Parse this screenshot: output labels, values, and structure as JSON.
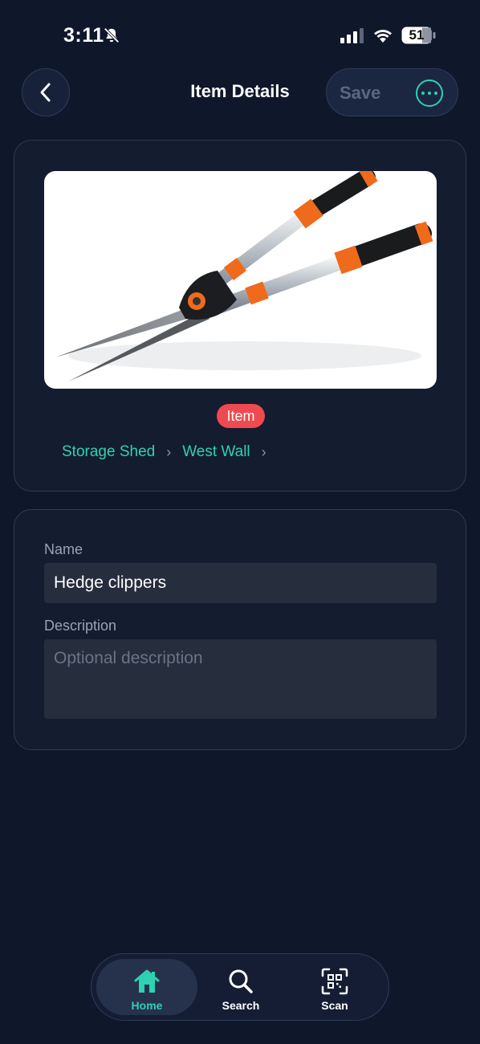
{
  "status_bar": {
    "time": "3:11",
    "battery": "51"
  },
  "header": {
    "title": "Item Details",
    "save_label": "Save"
  },
  "item": {
    "badge": "Item",
    "breadcrumb": [
      "Storage Shed",
      "West Wall"
    ],
    "name_label": "Name",
    "name_value": "Hedge clippers",
    "description_label": "Description",
    "description_placeholder": "Optional description"
  },
  "tabs": [
    {
      "label": "Home",
      "icon": "home-icon",
      "active": true
    },
    {
      "label": "Search",
      "icon": "search-icon",
      "active": false
    },
    {
      "label": "Scan",
      "icon": "qr-scan-icon",
      "active": false
    }
  ],
  "colors": {
    "background": "#0f172a",
    "accent": "#2fd1b3",
    "badge": "#ef4a4f"
  }
}
